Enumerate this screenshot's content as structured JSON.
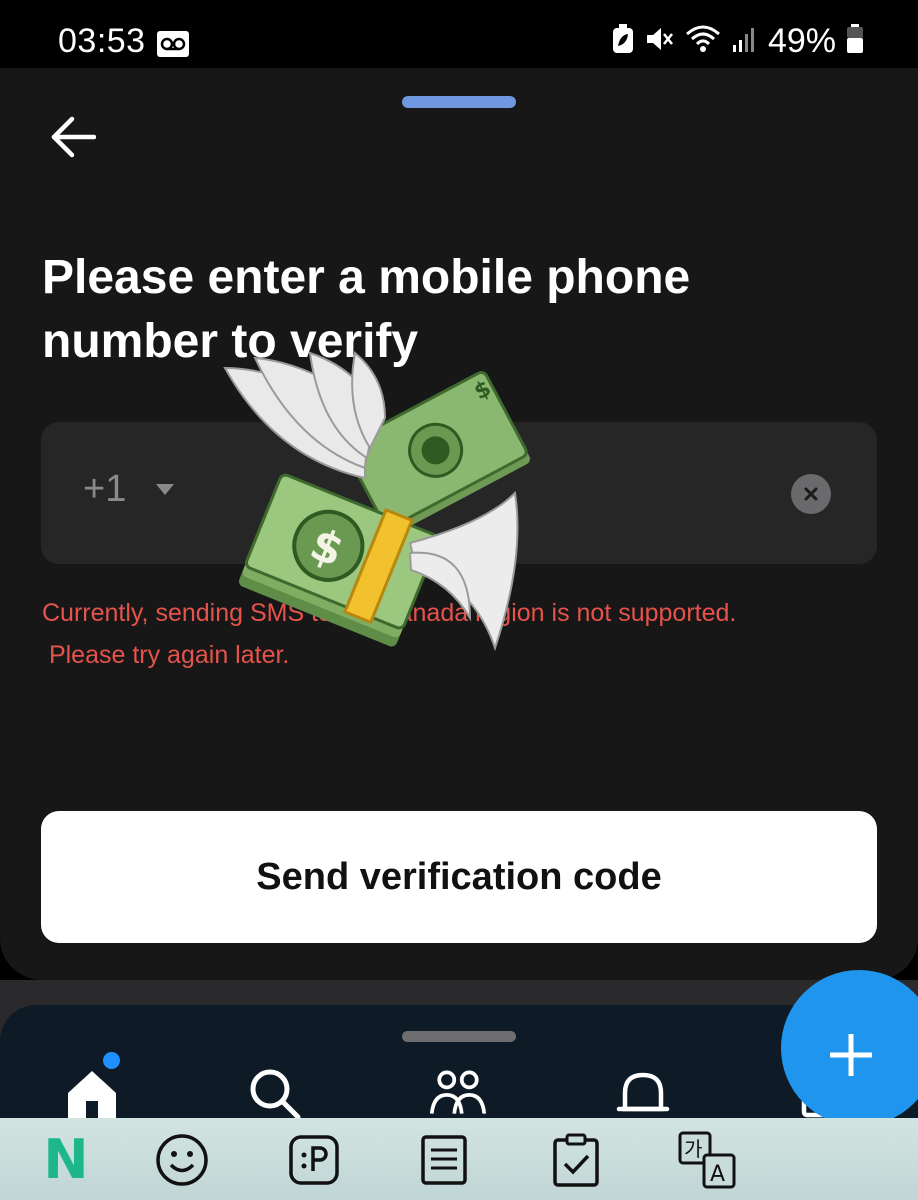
{
  "status_bar": {
    "time": "03:53",
    "battery": "49%",
    "icons": [
      "voicemail-icon",
      "battery-saver-icon",
      "mute-icon",
      "wifi-icon",
      "signal-icon",
      "battery-icon"
    ]
  },
  "sheet": {
    "title": "Please enter a mobile phone number to verify",
    "country_code": "+1",
    "phone_value": "",
    "error_line1": "Currently, sending SMS to US/Canada region is not supported.",
    "error_line2": " Please try again later.",
    "send_button": "Send verification code"
  },
  "bottom_nav": {
    "items": [
      "home-icon",
      "search-icon",
      "community-icon",
      "bell-icon",
      "inbox-icon"
    ],
    "has_notification": true
  },
  "keyboard_toolbar": {
    "logo": "N",
    "items": [
      "emoji-icon",
      "sticker-icon",
      "clipboard-icon",
      "checklist-icon",
      "translate-icon"
    ]
  },
  "colors": {
    "error": "#e5534b",
    "accent": "#1f95ee",
    "sheet_bg": "#171718",
    "handle": "#6f98e0"
  }
}
